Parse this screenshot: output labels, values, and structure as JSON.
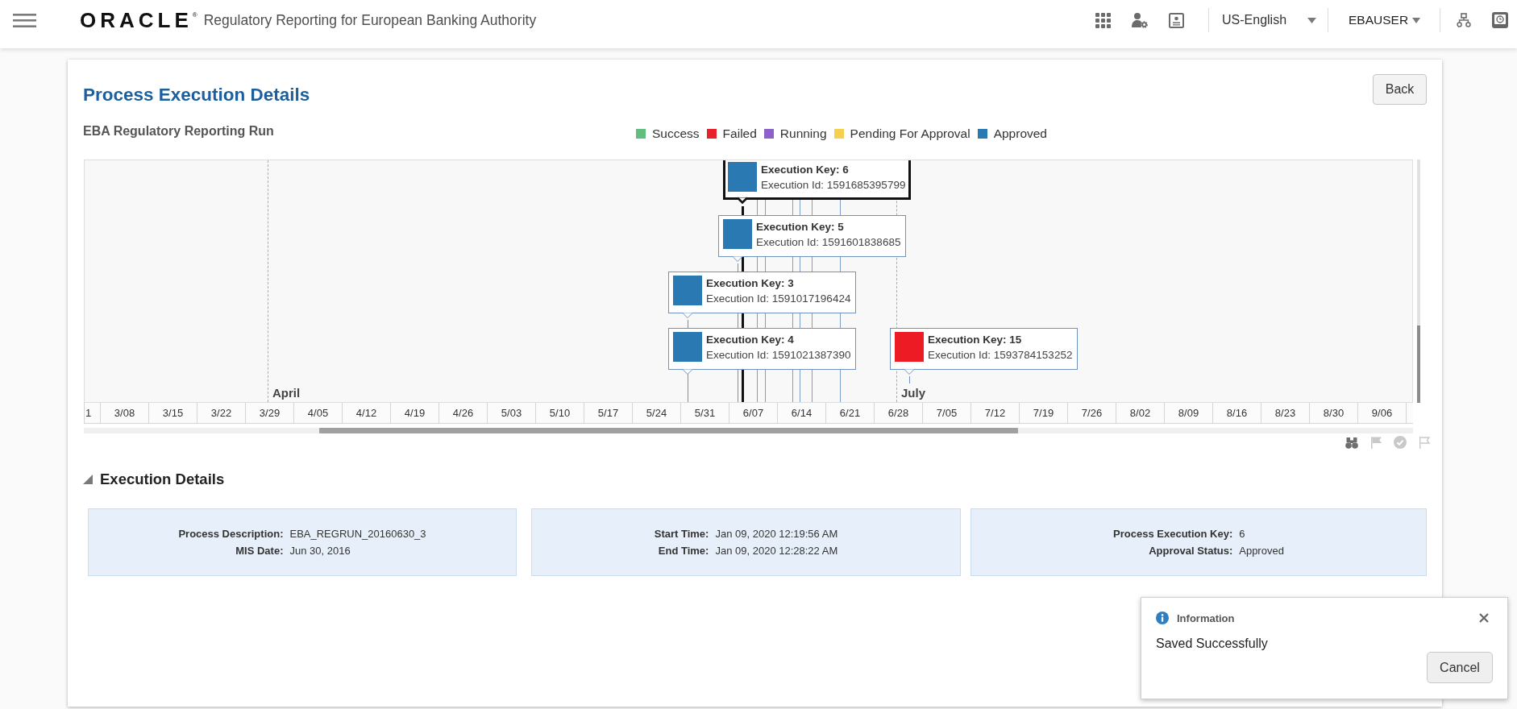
{
  "header": {
    "logo": "ORACLE$^{®}$",
    "title": "Regulatory Reporting for European Banking Authority",
    "language": "US-English",
    "user": "EBAUSER"
  },
  "page": {
    "title": "Process Execution Details",
    "back_button": "Back",
    "run_name": "EBA Regulatory Reporting Run"
  },
  "legend": [
    {
      "label": "Success",
      "color": "#62bd7e"
    },
    {
      "label": "Failed",
      "color": "#e8202a"
    },
    {
      "label": "Running",
      "color": "#8b62c9"
    },
    {
      "label": "Pending For Approval",
      "color": "#f6cf4f"
    },
    {
      "label": "Approved",
      "color": "#2a79b3"
    }
  ],
  "timeline": {
    "months": [
      "April",
      "July"
    ],
    "dates": [
      "1",
      "3/08",
      "3/15",
      "3/22",
      "3/29",
      "4/05",
      "4/12",
      "4/19",
      "4/26",
      "5/03",
      "5/10",
      "5/17",
      "5/24",
      "5/31",
      "6/07",
      "6/14",
      "6/21",
      "6/28",
      "7/05",
      "7/12",
      "7/19",
      "7/26",
      "8/02",
      "8/09",
      "8/16",
      "8/23",
      "8/30",
      "9/06"
    ],
    "events": [
      {
        "key": "Execution Key: 6",
        "id": "Execution Id: 1591685395799",
        "color": "#2a79b3",
        "selected": true
      },
      {
        "key": "Execution Key: 5",
        "id": "Execution Id: 1591601838685",
        "color": "#2a79b3",
        "selected": false
      },
      {
        "key": "Execution Key: 3",
        "id": "Execution Id: 1591017196424",
        "color": "#2a79b3",
        "selected": false
      },
      {
        "key": "Execution Key: 4",
        "id": "Execution Id: 1591021387390",
        "color": "#2a79b3",
        "selected": false
      },
      {
        "key": "Execution Key: 15",
        "id": "Execution Id: 1593784153252",
        "color": "#ed1c24",
        "selected": false
      }
    ]
  },
  "chart_toolbar": [
    {
      "kind": "binoculars",
      "disabled": false
    },
    {
      "kind": "flag",
      "disabled": true
    },
    {
      "kind": "check",
      "disabled": true
    },
    {
      "kind": "pennant",
      "disabled": true
    }
  ],
  "details": {
    "title": "Execution Details",
    "expanded": true,
    "panels": [
      {
        "rows": [
          {
            "label": "Process Description:",
            "value": "EBA_REGRUN_20160630_3"
          },
          {
            "label": "MIS Date:",
            "value": "Jun 30, 2016"
          }
        ]
      },
      {
        "rows": [
          {
            "label": "Start Time:",
            "value": "Jan 09, 2020 12:19:56 AM"
          },
          {
            "label": "End Time:",
            "value": "Jan 09, 2020 12:28:22 AM"
          }
        ]
      },
      {
        "rows": [
          {
            "label": "Process Execution Key:",
            "value": "6"
          },
          {
            "label": "Approval Status:",
            "value": "Approved"
          }
        ]
      }
    ]
  },
  "notification": {
    "title": "Information",
    "message": "Saved Successfully",
    "button": "Cancel"
  }
}
